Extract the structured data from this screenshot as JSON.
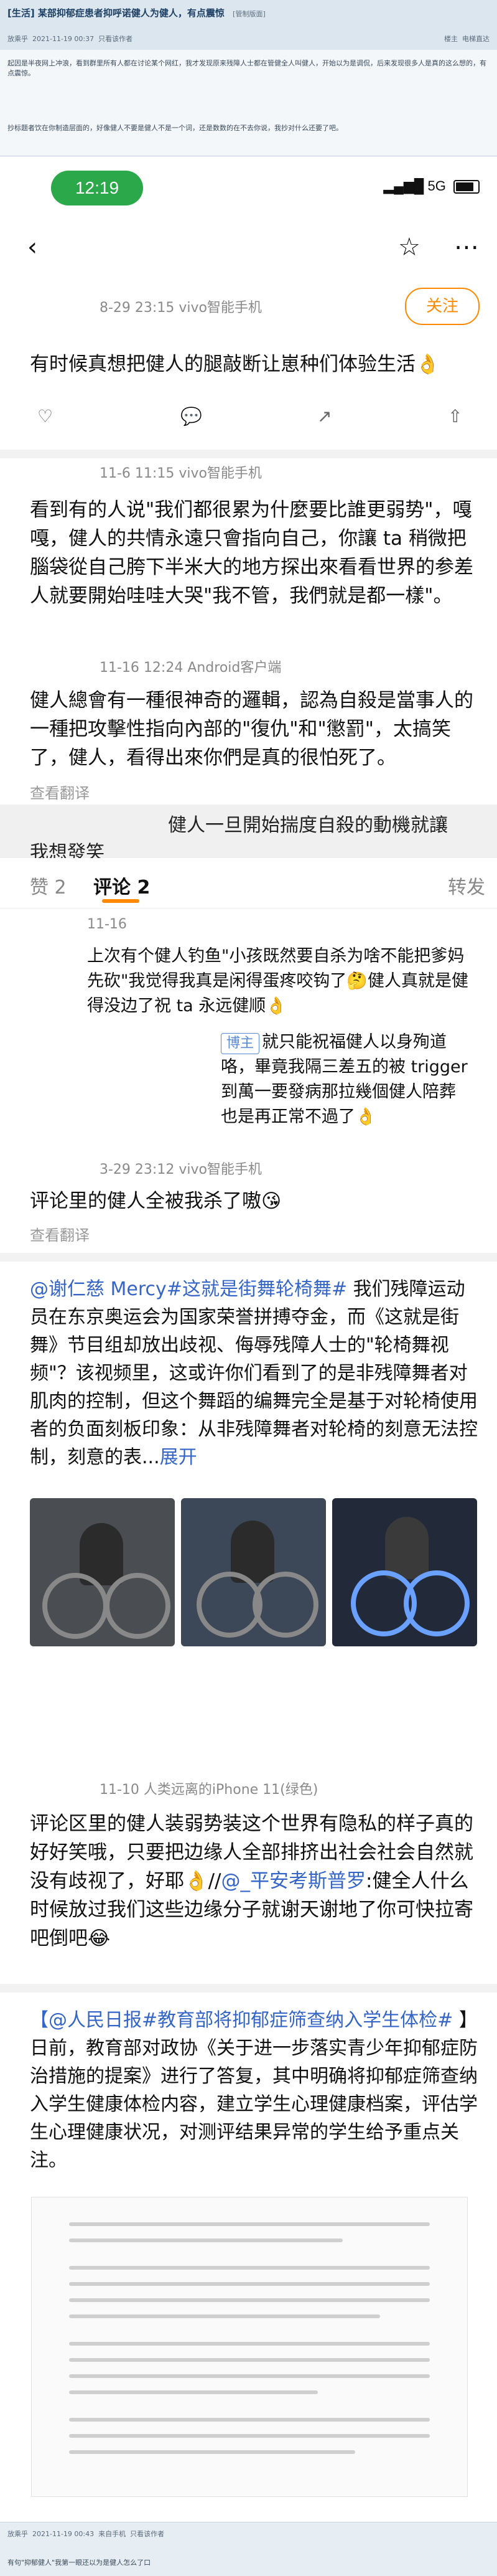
{
  "forum": {
    "title": "[生活] 某部抑郁症患者抑呼诺健人为健人，有点震惊",
    "manage": "[管制版面]",
    "poster": "放乘乎",
    "post_time": "2021-11-19 00:37",
    "poster_only": "只看该作者",
    "floor_label": "楼主",
    "reverse": "电梯直达",
    "para1": "起因是半夜网上冲浪，看到群里所有人都在讨论某个网红，我才发现原来残障人士都在管健全人叫健人，开始以为是调侃，后来发现很多人是真的这么想的，有点震惊。",
    "para2": "抄标题者饮在你制造层面的，好像健人不要是健人不是一个词，还是数数的在不去你说，我抄对什么还要了吧。"
  },
  "phone": {
    "time": "12:19",
    "network": "5G",
    "post1": {
      "meta": "8-29 23:15  vivo智能手机",
      "follow": "关注",
      "text": "有时候真想把健人的腿敲断让崽种们体验生活👌"
    },
    "post2": {
      "meta": "11-6 11:15  vivo智能手机",
      "text": "看到有的人说\"我们都很累为什麼要比誰更弱势\"，嘎嘎，健人的共情永遠只會指向自己，你讓 ta 稍微把腦袋從自己胯下半米大的地方探出來看看世界的参差人就要開始哇哇大哭\"我不管，我們就是都一樣\"。",
      "translate": "查看翻译"
    },
    "post3": {
      "meta": "11-16 12:24  Android客户端",
      "text": "健人總會有一種很神奇的邏輯，認為自殺是當事人的一種把攻擊性指向內部的\"復仇\"和\"懲罰\"，太搞笑了，健人，看得出來你們是真的很怕死了。",
      "translate": "查看翻译"
    },
    "gray_bar": {
      "line1": "健人一旦開始揣度自殺的動機就讓",
      "line2": "我想發笑"
    },
    "tabs": {
      "likes": "赞 2",
      "comments": "评论 2",
      "forward": "转发"
    },
    "comment1": {
      "date": "11-16",
      "text": "上次有个健人钓鱼\"小孩既然要自杀为啥不能把爹妈先砍\"我觉得我真是闲得蛋疼咬钩了🤔健人真就是健得没边了祝 ta 永远健顺👌",
      "blogger": "博主",
      "reply": "就只能祝福健人以身殉道咯，畢竟我隔三差五的被 trigger 到萬一要發病那拉幾個健人陪葬也是再正常不過了👌"
    },
    "post4": {
      "meta": "3-29 23:12  vivo智能手机",
      "text": "评论里的健人全被我杀了嗷😘",
      "translate": "查看翻译"
    },
    "post5": {
      "mention": "@谢仁慈 Mercy",
      "topic": "#这就是街舞轮椅舞#",
      "text": " 我们残障运动员在东京奥运会为国家荣誉拼搏夺金，而《这就是街舞》节目组却放出歧视、侮辱残障人士的\"轮椅舞视频\"？该视频里，这或许你们看到了的是非残障舞者对肌肉的控制，但这个舞蹈的编舞完全是基于对轮椅使用者的负面刻板印象：从非残障舞者对轮椅的刻意无法控制，刻意的表...",
      "expand": "展开"
    },
    "post6": {
      "meta": "11-10  人类远离的iPhone 11(绿色)",
      "text": "评论区里的健人装弱势装这个世界有隐私的样子真的好好笑哦，只要把边缘人全部排挤出社会社会自然就没有歧视了，好耶👌//",
      "mention": "@_平安考斯普罗",
      "text2": ":健全人什么时候放过我们这些边缘分子就谢天谢地了你可快拉寄吧倒吧😂"
    },
    "post7": {
      "mention": "@人民日报",
      "topic": "#教育部将抑郁症筛查纳入学生体检#",
      "text": " 】日前，教育部对政协《关于进一步落实青少年抑郁症防治措施的提案》进行了答复，其中明确将抑郁症筛查纳入学生健康体检内容，建立学生心理健康档案，评估学生心理健康状况，对测评结果异常的学生给予重点关注。",
      "bracket": "【"
    }
  },
  "footer": {
    "poster": "放乘乎",
    "time": "2021-11-19 00:43",
    "device": "来自手机",
    "poster_only": "只看该作者",
    "quote": "有句\"抑郁健人\"我第一眼还以为是健人怎么了口"
  }
}
